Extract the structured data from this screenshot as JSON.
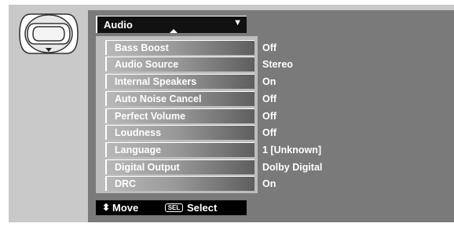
{
  "header": {
    "title": "Audio"
  },
  "menu": {
    "items": [
      {
        "label": "Bass Boost",
        "value": "Off"
      },
      {
        "label": "Audio Source",
        "value": "Stereo"
      },
      {
        "label": "Internal Speakers",
        "value": "On"
      },
      {
        "label": "Auto Noise Cancel",
        "value": "Off"
      },
      {
        "label": "Perfect Volume",
        "value": "Off"
      },
      {
        "label": "Loudness",
        "value": "Off"
      },
      {
        "label": "Language",
        "value": "1 [Unknown]"
      },
      {
        "label": "Digital Output",
        "value": "Dolby Digital"
      },
      {
        "label": "DRC",
        "value": "On"
      }
    ]
  },
  "footer": {
    "move_label": "Move",
    "sel_key": "SEL",
    "select_label": "Select"
  }
}
